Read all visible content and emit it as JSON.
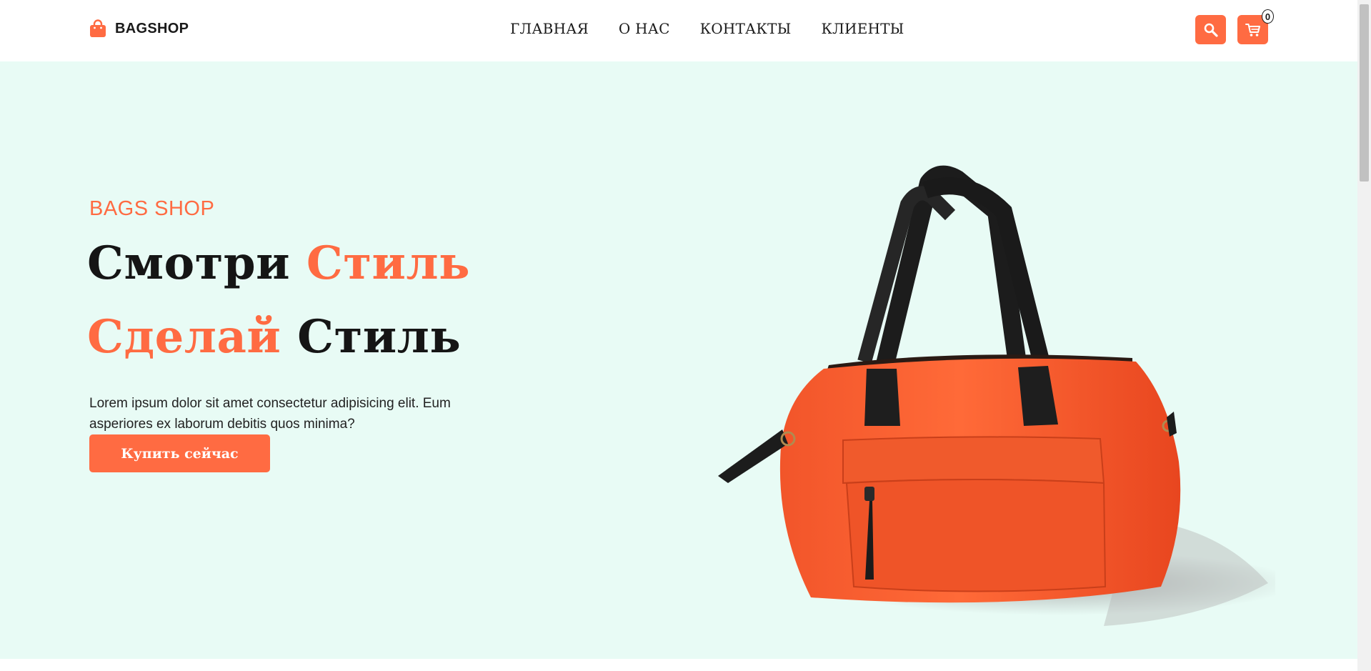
{
  "header": {
    "logo_text": "BAGSHOP",
    "logo_icon": "shopping-bag-icon",
    "nav": [
      {
        "label": "ГЛАВНАЯ"
      },
      {
        "label": "О НАС"
      },
      {
        "label": "КОНТАКТЫ"
      },
      {
        "label": "КЛИЕНТЫ"
      }
    ],
    "search_icon": "search-icon",
    "cart_icon": "cart-icon",
    "cart_count": "0"
  },
  "hero": {
    "eyebrow": "BAGS SHOP",
    "line1_dark": "Смотри",
    "line1_accent": "Стиль",
    "line2_accent": "Сделай",
    "line2_dark": "Стиль",
    "description": "Lorem ipsum dolor sit amet consectetur adipisicing elit. Eum asperiores ex laborum debitis quos minima?",
    "cta_label": "Купить сейчас",
    "image": "orange-handbag"
  },
  "colors": {
    "accent": "#ff6b42",
    "hero_bg": "#e8fbf5",
    "text": "#151515"
  }
}
